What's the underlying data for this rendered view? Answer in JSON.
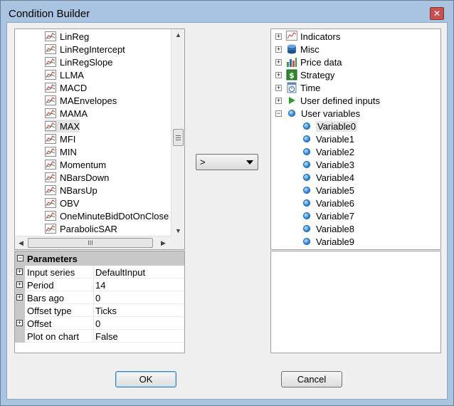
{
  "window": {
    "title": "Condition Builder"
  },
  "functions": {
    "items": [
      {
        "label": "LinReg"
      },
      {
        "label": "LinRegIntercept"
      },
      {
        "label": "LinRegSlope"
      },
      {
        "label": "LLMA"
      },
      {
        "label": "MACD"
      },
      {
        "label": "MAEnvelopes"
      },
      {
        "label": "MAMA"
      },
      {
        "label": "MAX",
        "selected": true
      },
      {
        "label": "MFI"
      },
      {
        "label": "MIN"
      },
      {
        "label": "Momentum"
      },
      {
        "label": "NBarsDown"
      },
      {
        "label": "NBarsUp"
      },
      {
        "label": "OBV"
      },
      {
        "label": "OneMinuteBidDotOnClose"
      },
      {
        "label": "ParabolicSAR"
      }
    ]
  },
  "parameters": {
    "header": "Parameters",
    "rows": [
      {
        "name": "Input series",
        "value": "DefaultInput",
        "expandable": true
      },
      {
        "name": "Period",
        "value": "14",
        "expandable": true
      },
      {
        "name": "Bars ago",
        "value": "0",
        "expandable": true
      },
      {
        "name": "Offset type",
        "value": "Ticks",
        "expandable": false
      },
      {
        "name": "Offset",
        "value": "0",
        "expandable": true
      },
      {
        "name": "Plot on chart",
        "value": "False",
        "expandable": false
      }
    ]
  },
  "condition": {
    "value": ">"
  },
  "tree": {
    "groups": [
      {
        "label": "Indicators",
        "icon": "indicators-icon"
      },
      {
        "label": "Misc",
        "icon": "misc-icon"
      },
      {
        "label": "Price data",
        "icon": "price-data-icon"
      },
      {
        "label": "Strategy",
        "icon": "strategy-icon"
      },
      {
        "label": "Time",
        "icon": "time-icon"
      },
      {
        "label": "User defined inputs",
        "icon": "user-inputs-icon"
      },
      {
        "label": "User variables",
        "icon": "user-variables-icon",
        "expanded": true
      }
    ],
    "variables": [
      {
        "label": "Variable0",
        "selected": true
      },
      {
        "label": "Variable1"
      },
      {
        "label": "Variable2"
      },
      {
        "label": "Variable3"
      },
      {
        "label": "Variable4"
      },
      {
        "label": "Variable5"
      },
      {
        "label": "Variable6"
      },
      {
        "label": "Variable7"
      },
      {
        "label": "Variable8"
      },
      {
        "label": "Variable9"
      }
    ]
  },
  "buttons": {
    "ok": "OK",
    "cancel": "Cancel"
  },
  "icons": {
    "close": "close-icon",
    "expand": "⊞",
    "collapse": "⊟",
    "scroll_mid": "III"
  },
  "colors": {
    "titlebar": "#a8c4e0",
    "close": "#c75050",
    "variable_dot": "#2a8be0"
  }
}
